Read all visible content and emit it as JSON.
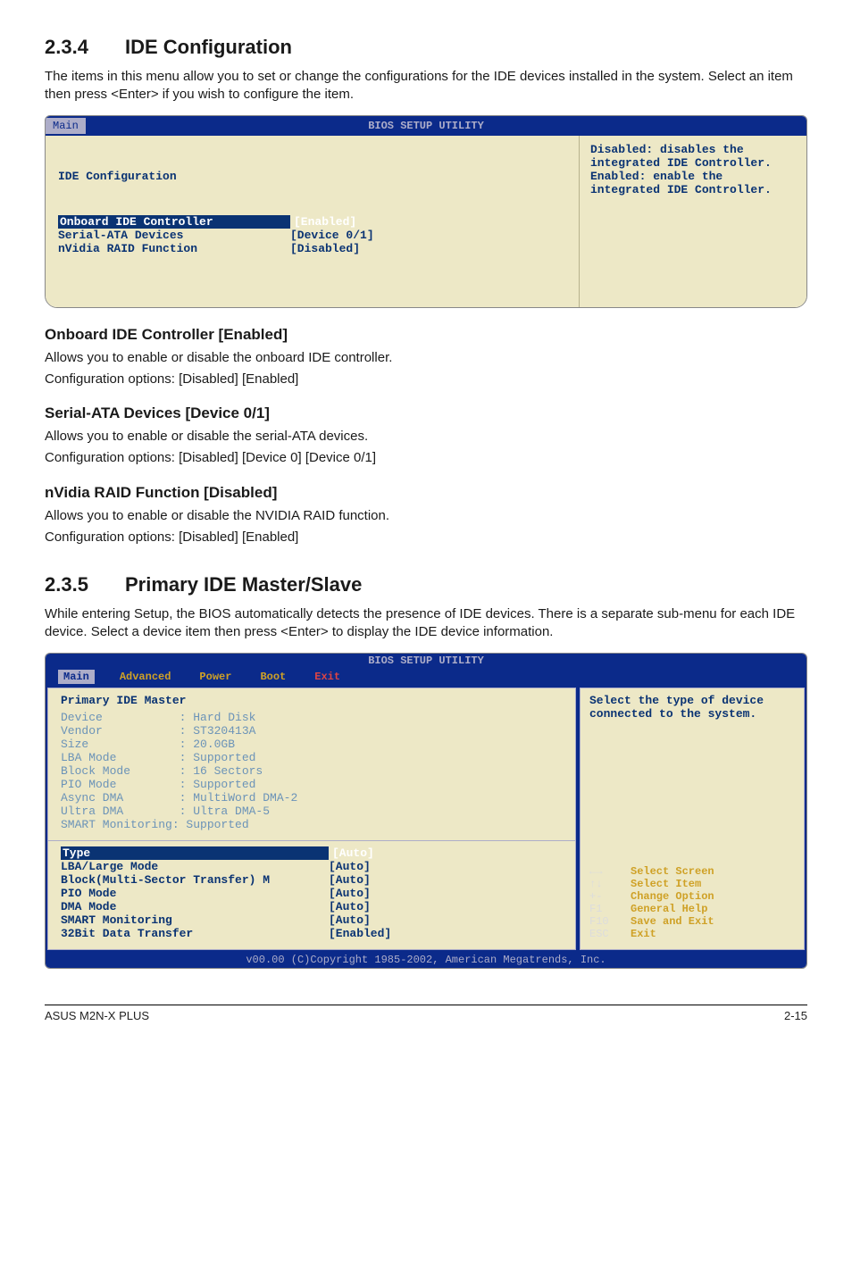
{
  "section1": {
    "num": "2.3.4",
    "title": "IDE Configuration",
    "intro": "The items in this menu allow you to set or change the configurations for the IDE devices installed in the system. Select an item then press <Enter> if you wish to configure the item."
  },
  "bios1": {
    "topbar_title": "BIOS SETUP UTILITY",
    "tab_active": "Main",
    "panel_title": "IDE Configuration",
    "rows": [
      {
        "label": "Onboard IDE Controller",
        "value": "[Enabled]",
        "selected": true
      },
      {
        "label": "Serial-ATA Devices",
        "value": "[Device 0/1]",
        "selected": false
      },
      {
        "label": "",
        "value": "",
        "selected": false
      },
      {
        "label": "nVidia RAID Function",
        "value": "[Disabled]",
        "selected": false
      }
    ],
    "help": "Disabled: disables the integrated IDE Controller.\nEnabled: enable the integrated IDE Controller."
  },
  "sub1": {
    "heading": "Onboard IDE Controller [Enabled]",
    "line1": "Allows you to enable or disable the onboard IDE controller.",
    "line2": "Configuration options: [Disabled] [Enabled]"
  },
  "sub2": {
    "heading": "Serial-ATA Devices [Device 0/1]",
    "line1": "Allows you to enable or disable the serial-ATA devices.",
    "line2": "Configuration options: [Disabled] [Device 0] [Device 0/1]"
  },
  "sub3": {
    "heading": "nVidia RAID Function [Disabled]",
    "line1": "Allows you to enable or disable the NVIDIA RAID function.",
    "line2": "Configuration options: [Disabled] [Enabled]"
  },
  "section2": {
    "num": "2.3.5",
    "title": "Primary IDE Master/Slave",
    "intro": "While entering Setup, the BIOS automatically detects the presence of IDE devices. There is a separate sub-menu for each IDE device. Select a device item then press <Enter> to display the IDE device information."
  },
  "bios2": {
    "topbar_title": "BIOS SETUP UTILITY",
    "menus": {
      "active": "Main",
      "items": [
        "Advanced",
        "Power",
        "Boot",
        "Exit"
      ]
    },
    "panel_title": "Primary IDE Master",
    "info": [
      "Device           : Hard Disk",
      "Vendor           : ST320413A",
      "Size             : 20.0GB",
      "LBA Mode         : Supported",
      "Block Mode       : 16 Sectors",
      "PIO Mode         : Supported",
      "Async DMA        : MultiWord DMA-2",
      "Ultra DMA        : Ultra DMA-5",
      "SMART Monitoring: Supported"
    ],
    "settings": [
      {
        "label": "Type",
        "value": "[Auto]",
        "selected": true
      },
      {
        "label": "LBA/Large Mode",
        "value": "[Auto]",
        "selected": false
      },
      {
        "label": "Block(Multi-Sector Transfer) M",
        "value": "[Auto]",
        "selected": false
      },
      {
        "label": "PIO Mode",
        "value": "[Auto]",
        "selected": false
      },
      {
        "label": "DMA Mode",
        "value": "[Auto]",
        "selected": false
      },
      {
        "label": "SMART Monitoring",
        "value": "[Auto]",
        "selected": false
      },
      {
        "label": "32Bit Data Transfer",
        "value": "[Enabled]",
        "selected": false
      }
    ],
    "help": "Select the type of device connected to the system.",
    "keys": [
      {
        "k": "←→",
        "d": "Select Screen"
      },
      {
        "k": "↑↓",
        "d": "Select Item"
      },
      {
        "k": "+-",
        "d": "Change Option"
      },
      {
        "k": "F1",
        "d": "General Help"
      },
      {
        "k": "F10",
        "d": "Save and Exit"
      },
      {
        "k": "ESC",
        "d": "Exit"
      }
    ],
    "footer": "v00.00 (C)Copyright 1985-2002, American Megatrends, Inc."
  },
  "footer": {
    "left": "ASUS M2N-X PLUS",
    "right": "2-15"
  }
}
